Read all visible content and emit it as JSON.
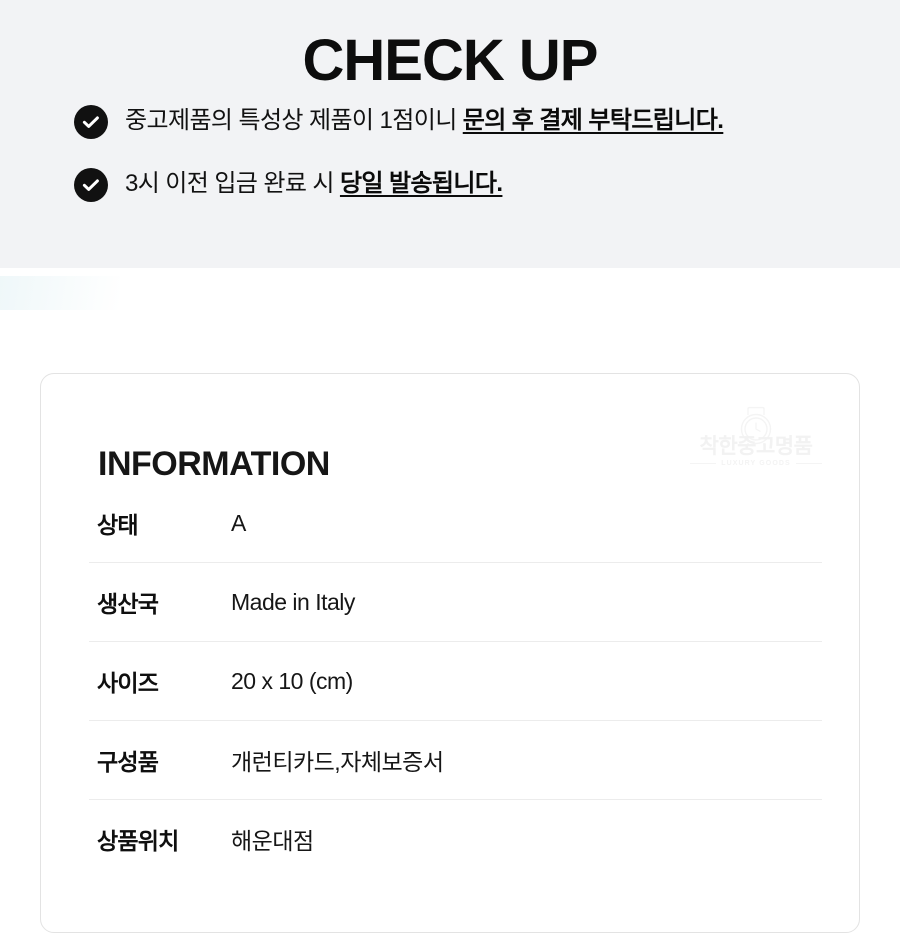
{
  "checkup": {
    "title": "CHECK UP",
    "items": [
      {
        "icon": "check-circle-icon",
        "text_plain": "중고제품의 특성상 제품이 1점이니 ",
        "text_emphasis": "문의 후 결제 부탁드립니다."
      },
      {
        "icon": "check-circle-icon",
        "text_plain": "3시 이전 입금 완료 시 ",
        "text_emphasis": "당일 발송됩니다."
      }
    ]
  },
  "information": {
    "heading": "INFORMATION",
    "brand": {
      "mark": "watch-icon",
      "name": "착한중고명품",
      "subtitle": "LUXURY GOODS"
    },
    "rows": [
      {
        "label": "상태",
        "value": "A"
      },
      {
        "label": "생산국",
        "value": "Made in Italy"
      },
      {
        "label": "사이즈",
        "value": "20 x 10 (cm)"
      },
      {
        "label": "구성품",
        "value": "개런티카드,자체보증서"
      },
      {
        "label": "상품위치",
        "value": "해운대점"
      }
    ]
  },
  "colors": {
    "band_background": "#f2f3f5",
    "page_background": "#ffffff",
    "text_primary": "#121212",
    "icon_fill": "#111111",
    "icon_glyph": "#ffffff",
    "card_border": "#e3e3e3",
    "row_divider": "#ececec",
    "watermark": "#f3f3f3"
  }
}
